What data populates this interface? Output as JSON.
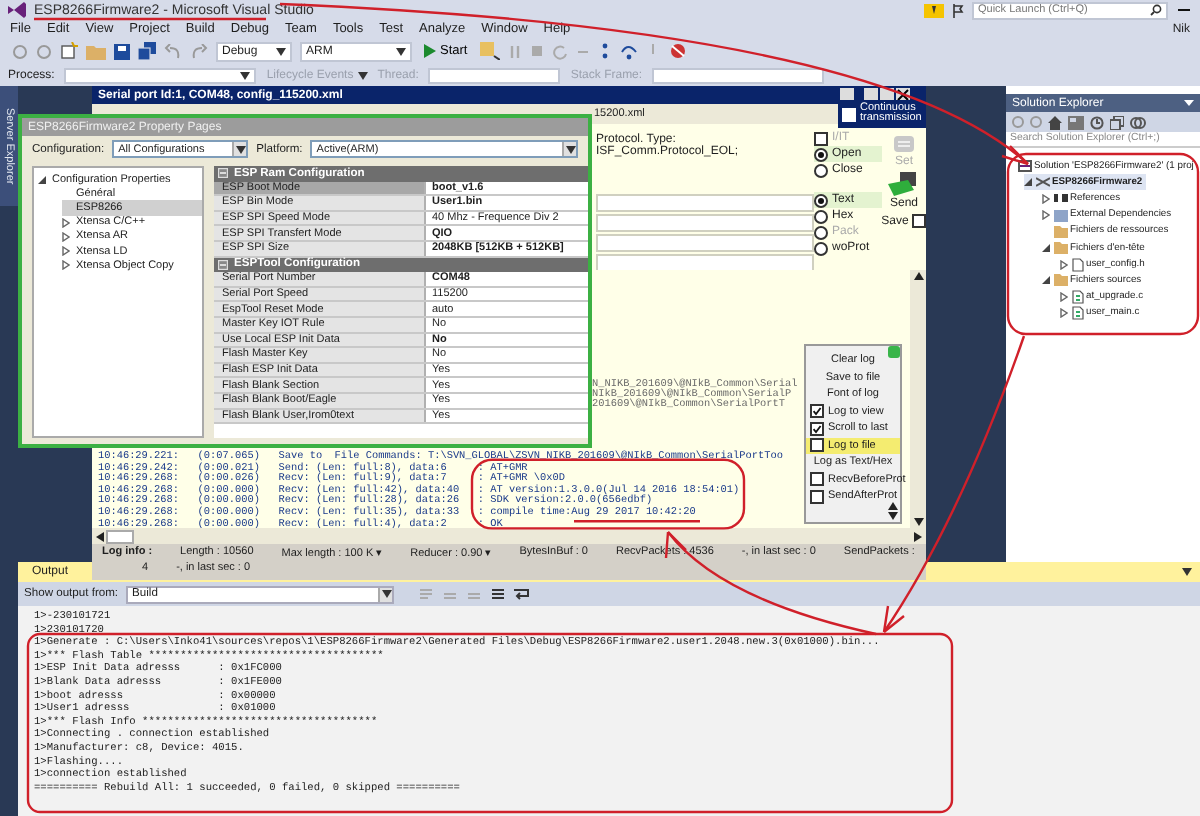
{
  "window": {
    "title": "ESP8266Firmware2 - Microsoft Visual Studio"
  },
  "quick_launch": {
    "placeholder": "Quick Launch (Ctrl+Q)"
  },
  "user": "Nik",
  "menu": [
    "File",
    "Edit",
    "View",
    "Project",
    "Build",
    "Debug",
    "Team",
    "Tools",
    "Test",
    "Analyze",
    "Window",
    "Help"
  ],
  "toolbar": {
    "configuration": "Debug",
    "platform": "ARM",
    "start": "Start"
  },
  "debug_bar": {
    "process_label": "Process:",
    "lifecycle": "Lifecycle Events",
    "thread_label": "Thread:",
    "stack_frame": "Stack Frame:"
  },
  "server_explorer": "Server Explorer",
  "serial_port": {
    "title": "Serial port  Id:1,  COM48,  config_115200.xml",
    "file_tail": "15200.xml",
    "continuous": {
      "label": "Continuous transmission",
      "checked": false
    },
    "protocol": "Protocol. Type: ISF_Comm.Protocol_EOL;",
    "io_toggle": {
      "label": "I/IT",
      "checked": false,
      "disabled": true
    },
    "port_options": [
      {
        "label": "Open",
        "selected": true
      },
      {
        "label": "Close",
        "selected": false
      }
    ],
    "format_options": [
      {
        "label": "Text",
        "selected": true,
        "disabled": false
      },
      {
        "label": "Hex",
        "selected": false,
        "disabled": false
      },
      {
        "label": "Pack",
        "selected": false,
        "disabled": true
      },
      {
        "label": "woProt",
        "selected": false,
        "disabled": false
      }
    ],
    "set_button": {
      "label": "Set",
      "disabled": true
    },
    "send_button": {
      "label": "Send",
      "disabled": false
    },
    "save": {
      "label": "Save",
      "checked": false
    },
    "log_lines": [
      {
        "kind": "fragment",
        "text": "N_NIKB_201609\\@NIkB_Common\\Serial"
      },
      {
        "kind": "fragment",
        "text": "NIkB_201609\\@NIkB_Common\\SerialP"
      },
      {
        "kind": "fragment",
        "text": "201609\\@NIkB_Common\\SerialPortT"
      },
      {
        "kind": "entry",
        "text": "10:46:29.221:   (0:07.065)   Save to  File Commands: T:\\SVN_GLOBAL\\ZSVN_NIKB_201609\\@NIkB_Common\\SerialPortToo"
      },
      {
        "kind": "entry",
        "text": "10:46:29.242:   (0:00.021)   Send: (Len: full:8), data:6     : AT+GMR"
      },
      {
        "kind": "entry",
        "text": "10:46:29.268:   (0:00.026)   Recv: (Len: full:9), data:7     : AT+GMR \\0x0D"
      },
      {
        "kind": "entry",
        "text": "10:46:29.268:   (0:00.000)   Recv: (Len: full:42), data:40   : AT version:1.3.0.0(Jul 14 2016 18:54:01)"
      },
      {
        "kind": "entry",
        "text": "10:46:29.268:   (0:00.000)   Recv: (Len: full:28), data:26   : SDK version:2.0.0(656edbf)"
      },
      {
        "kind": "entry",
        "text": "10:46:29.268:   (0:00.000)   Recv: (Len: full:35), data:33   : compile time:Aug 29 2017 10:42:20"
      },
      {
        "kind": "entry",
        "text": "10:46:29.268:   (0:00.000)   Recv: (Len: full:4), data:2     : OK"
      }
    ],
    "context_menu": [
      {
        "kind": "action",
        "label": "Clear log",
        "selected": false
      },
      {
        "kind": "action",
        "label": "Save to file",
        "selected": false
      },
      {
        "kind": "action",
        "label": "Font of log",
        "selected": false
      },
      {
        "kind": "check",
        "label": "Log to view",
        "checked": true,
        "selected": false
      },
      {
        "kind": "check",
        "label": "Scroll to last",
        "checked": true,
        "selected": false
      },
      {
        "kind": "check",
        "label": "Log to file",
        "checked": false,
        "selected": true
      },
      {
        "kind": "action",
        "label": "Log as Text/Hex",
        "selected": false
      },
      {
        "kind": "check",
        "label": "RecvBeforeProt",
        "checked": false,
        "selected": false
      },
      {
        "kind": "check",
        "label": "SendAfterProt",
        "checked": false,
        "selected": false
      }
    ],
    "status_row_1": [
      "Log info :",
      "Length :  10560",
      "Max length :  100 K ▾",
      "Reducer :  0.90 ▾",
      "BytesInBuf :  0",
      "RecvPackets :  4536",
      "-, in last sec :  0",
      "SendPackets :"
    ],
    "status_row_2": [
      "4",
      "-, in last sec :  0"
    ]
  },
  "property_pages": {
    "title": "ESP8266Firmware2 Property Pages",
    "configuration_label": "Configuration:",
    "configuration": "All Configurations",
    "platform_label": "Platform:",
    "platform": "Active(ARM)",
    "tree": [
      {
        "label": "Configuration Properties",
        "expanded": true,
        "selected": false,
        "children": [
          {
            "label": "Général",
            "selected": false
          },
          {
            "label": "ESP8266",
            "selected": true
          },
          {
            "label": "Xtensa C/C++",
            "expanded": false,
            "selected": false
          },
          {
            "label": "Xtensa AR",
            "expanded": false,
            "selected": false
          },
          {
            "label": "Xtensa LD",
            "expanded": false,
            "selected": false
          },
          {
            "label": "Xtensa Object Copy",
            "expanded": false,
            "selected": false
          }
        ]
      }
    ],
    "sections": [
      {
        "title": "ESP Ram Configuration",
        "expanded": true,
        "rows": [
          {
            "name": "ESP Boot Mode",
            "value": "boot_v1.6",
            "bold": true,
            "selected": true
          },
          {
            "name": "ESP Bin Mode",
            "value": "User1.bin",
            "bold": true,
            "selected": false
          },
          {
            "name": "ESP SPI Speed Mode",
            "value": "40 Mhz - Frequence Div 2",
            "bold": false,
            "selected": false
          },
          {
            "name": "ESP SPI Transfert Mode",
            "value": "QIO",
            "bold": true,
            "selected": false
          },
          {
            "name": "ESP SPI Size",
            "value": "2048KB [512KB + 512KB]",
            "bold": true,
            "selected": false
          }
        ]
      },
      {
        "title": "ESPTool Configuration",
        "expanded": true,
        "rows": [
          {
            "name": "Serial Port Number",
            "value": "COM48",
            "bold": true,
            "selected": false
          },
          {
            "name": "Serial Port Speed",
            "value": "115200",
            "bold": false,
            "selected": false
          },
          {
            "name": "EspTool Reset Mode",
            "value": "auto",
            "bold": false,
            "selected": false
          },
          {
            "name": "Master Key IOT Rule",
            "value": "No",
            "bold": false,
            "selected": false
          },
          {
            "name": "Use Local ESP Init Data",
            "value": "No",
            "bold": true,
            "selected": false
          },
          {
            "name": "Flash Master Key",
            "value": "No",
            "bold": false,
            "selected": false
          },
          {
            "name": "Flash ESP Init Data",
            "value": "Yes",
            "bold": false,
            "selected": false
          },
          {
            "name": "Flash Blank Section",
            "value": "Yes",
            "bold": false,
            "selected": false
          },
          {
            "name": "Flash Blank Boot/Eagle",
            "value": "Yes",
            "bold": false,
            "selected": false
          },
          {
            "name": "Flash Blank User,Irom0text",
            "value": "Yes",
            "bold": false,
            "selected": false
          }
        ]
      }
    ]
  },
  "solution_explorer": {
    "title": "Solution Explorer",
    "search": {
      "placeholder": "Search Solution Explorer (Ctrl+;)"
    },
    "tree": [
      {
        "kind": "solution",
        "label": "Solution 'ESP8266Firmware2' (1 proj",
        "selected": false,
        "children": [
          {
            "kind": "project",
            "label": "ESP8266Firmware2",
            "expanded": true,
            "selected": true,
            "children": [
              {
                "kind": "references",
                "label": "References",
                "expanded": false,
                "selected": false
              },
              {
                "kind": "dependencies",
                "label": "External Dependencies",
                "expanded": false,
                "selected": false
              },
              {
                "kind": "folder",
                "label": "Fichiers de ressources",
                "selected": false
              },
              {
                "kind": "folder",
                "label": "Fichiers d'en-tête",
                "expanded": true,
                "selected": false,
                "children": [
                  {
                    "kind": "file",
                    "label": "user_config.h",
                    "expanded": false,
                    "selected": false
                  }
                ]
              },
              {
                "kind": "folder",
                "label": "Fichiers sources",
                "expanded": true,
                "selected": false,
                "children": [
                  {
                    "kind": "code",
                    "label": "at_upgrade.c",
                    "expanded": false,
                    "selected": false
                  },
                  {
                    "kind": "code",
                    "label": "user_main.c",
                    "expanded": false,
                    "selected": false
                  }
                ]
              }
            ]
          }
        ]
      }
    ]
  },
  "output": {
    "title": "Output",
    "show_from_label": "Show output from:",
    "source": "Build",
    "lines": [
      "1>-230101721",
      "1>230101720",
      "1>Generate : C:\\Users\\Inko41\\sources\\repos\\1\\ESP8266Firmware2\\Generated Files\\Debug\\ESP8266Firmware2.user1.2048.new.3(0x01000).bin...",
      "1>*** Flash Table *************************************",
      "1>ESP Init Data adresss      : 0x1FC000",
      "1>Blank Data adresss         : 0x1FE000",
      "1>boot adresss               : 0x00000",
      "1>User1 adresss              : 0x01000",
      "1>*** Flash Info *************************************",
      "1>Connecting . connection established",
      "1>Manufacturer: c8, Device: 4015.",
      "1>Flashing....",
      "1>connection established",
      "========== Rebuild All: 1 succeeded, 0 failed, 0 skipped =========="
    ]
  }
}
